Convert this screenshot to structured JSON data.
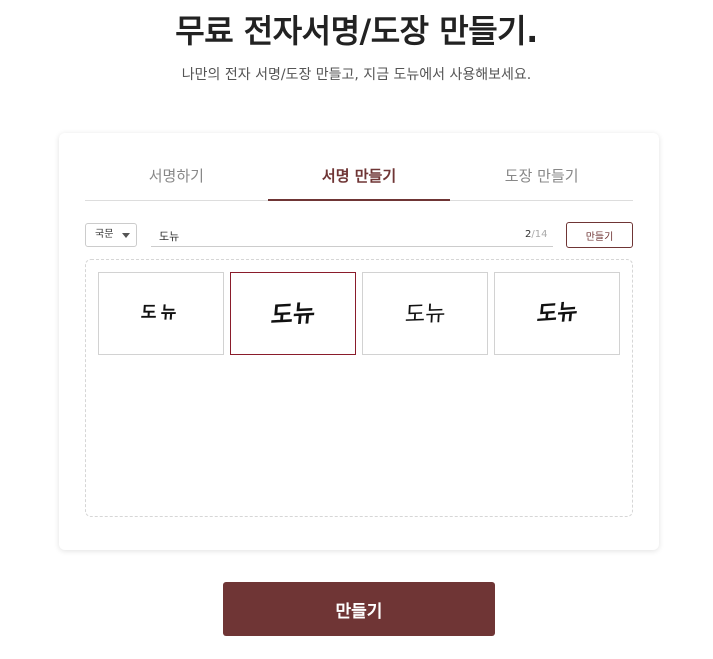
{
  "page": {
    "title": "무료 전자서명/도장 만들기.",
    "subtitle": "나만의 전자 서명/도장 만들고, 지금 도뉴에서 사용해보세요."
  },
  "tabs": [
    {
      "label": "서명하기",
      "active": false
    },
    {
      "label": "서명 만들기",
      "active": true
    },
    {
      "label": "도장 만들기",
      "active": false
    }
  ],
  "form": {
    "language_select": "국문",
    "name_value": "도뉴",
    "char_count": "2",
    "char_max": "/14",
    "make_button": "만들기"
  },
  "signatures": [
    {
      "text": "도뉴",
      "selected": false
    },
    {
      "text": "도뉴",
      "selected": true
    },
    {
      "text": "도뉴",
      "selected": false
    },
    {
      "text": "도뉴",
      "selected": false
    }
  ],
  "footer": {
    "make_button": "만들기"
  },
  "colors": {
    "accent": "#6f3535",
    "selected_border": "#8a1c2b"
  }
}
